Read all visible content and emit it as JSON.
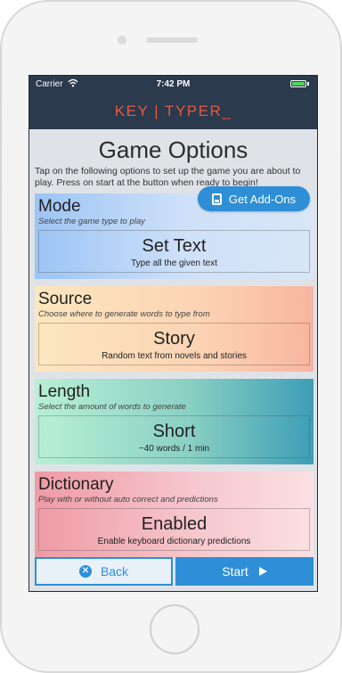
{
  "statusbar": {
    "carrier": "Carrier",
    "time": "7:42 PM"
  },
  "app": {
    "title": "KEY | TYPER_"
  },
  "page": {
    "title": "Game Options",
    "intro": "Tap on the following options to set up the game you are about to play. Press on start at the button when ready to begin!"
  },
  "addons_button": {
    "label": "Get Add-Ons",
    "icon": "store-icon"
  },
  "options": {
    "mode": {
      "title": "Mode",
      "subtitle": "Select the game type to play",
      "value": "Set Text",
      "description": "Type all the given text"
    },
    "source": {
      "title": "Source",
      "subtitle": "Choose where to generate words to type from",
      "value": "Story",
      "description": "Random text from novels and stories"
    },
    "length": {
      "title": "Length",
      "subtitle": "Select the amount of words to generate",
      "value": "Short",
      "description": "~40 words / 1 min"
    },
    "dictionary": {
      "title": "Dictionary",
      "subtitle": "Play with or without auto correct and predictions",
      "value": "Enabled",
      "description": "Enable keyboard dictionary predictions"
    }
  },
  "footer": {
    "back_label": "Back",
    "start_label": "Start"
  },
  "colors": {
    "accent": "#2e8fd6",
    "navbar": "#2b3a4c",
    "brand": "#e8573f",
    "battery": "#4cd964"
  }
}
